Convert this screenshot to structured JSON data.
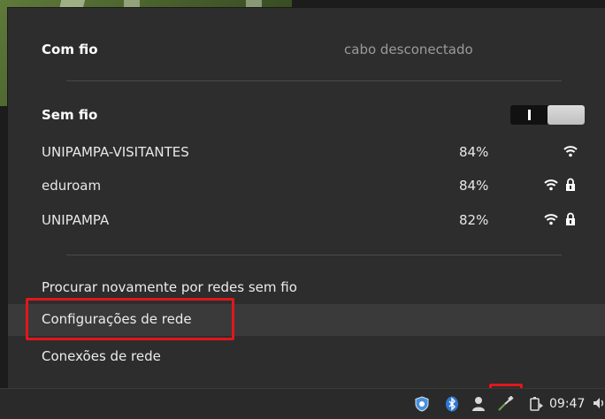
{
  "wired": {
    "title": "Com fio",
    "status": "cabo desconectado"
  },
  "wireless": {
    "title": "Sem fio",
    "enabled": true,
    "networks": [
      {
        "name": "UNIPAMPA-VISITANTES",
        "strength": "84%",
        "secured": false
      },
      {
        "name": "eduroam",
        "strength": "84%",
        "secured": true
      },
      {
        "name": "UNIPAMPA",
        "strength": "82%",
        "secured": true
      }
    ]
  },
  "actions": {
    "rescan": "Procurar novamente por redes sem fio",
    "network_settings": "Configurações de rede",
    "network_connections": "Conexões de rede"
  },
  "taskbar": {
    "clock": "09:47",
    "icons": [
      "shield-icon",
      "bluetooth-icon",
      "user-icon",
      "network-cable-icon",
      "battery-icon",
      "volume-icon"
    ]
  },
  "colors": {
    "menu_bg": "#2d2d2d",
    "highlight": "#e1171b",
    "hover_bg": "#3a3a3a"
  }
}
